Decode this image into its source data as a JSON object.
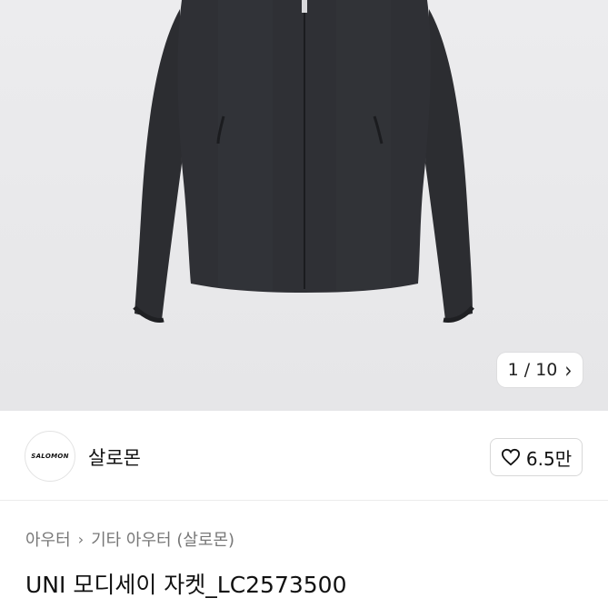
{
  "pager": {
    "current": "1 / 10",
    "next_icon": "chevron-right-icon"
  },
  "shop": {
    "logo_text": "SALOMON",
    "name": "살로몬",
    "likes": "6.5만",
    "like_icon": "heart-outline-icon"
  },
  "breadcrumb": {
    "items": [
      "아우터",
      "기타 아우터 (살로몬)"
    ],
    "separator_icon": "chevron-right-icon"
  },
  "product": {
    "title": "UNI 모디세이 자켓_LC2573500",
    "image_colors": {
      "jacket": "#2a2b2f",
      "background": "#e9e9eb"
    }
  }
}
